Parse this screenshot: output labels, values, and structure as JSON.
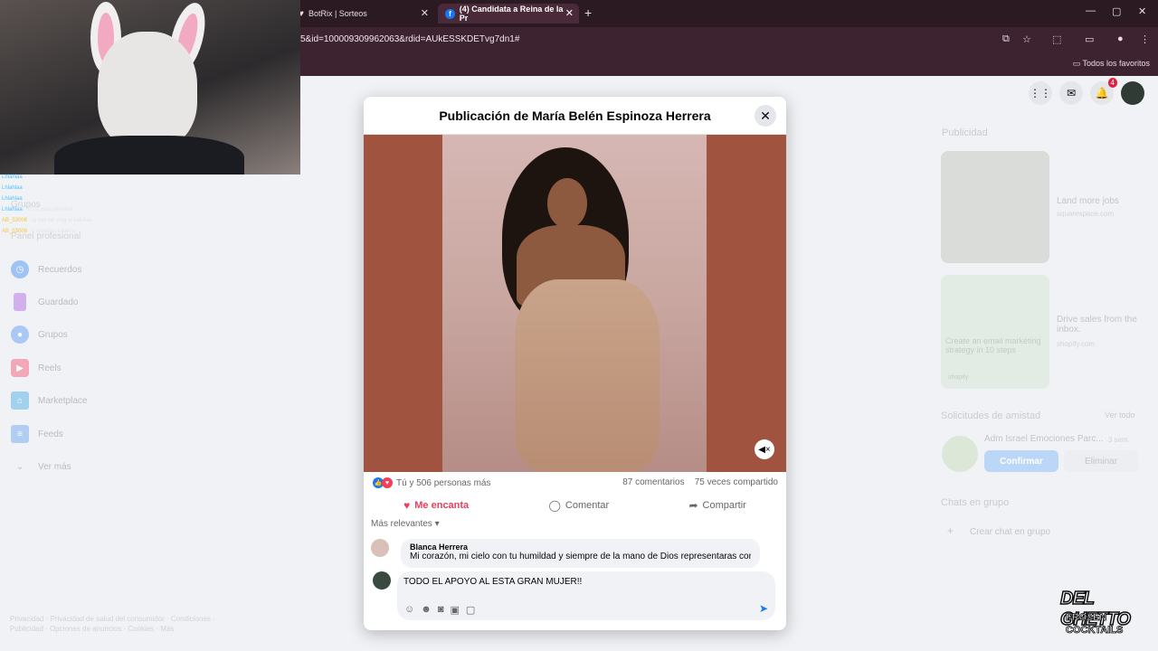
{
  "browser": {
    "tabs": [
      {
        "label": "BotRix | Sorteos"
      },
      {
        "label": "(4) Candidata a Reina de la Pr"
      }
    ],
    "url": "5&id=100009309962063&rdid=AUkESSKDETvg7dn1#",
    "bookmarks_label": "Todos los favoritos"
  },
  "chat_overlay": [
    {
      "name": "Lhlahlaa",
      "text": ":"
    },
    {
      "name": "Lhlahlaa",
      "text": ":"
    },
    {
      "name": "Lhlahlaa",
      "text": ":"
    },
    {
      "name": "Lhlahlaa",
      "text": ": Yo lo paso premios"
    },
    {
      "name": "AB_53006",
      "text": ": la sas vel v/ng al kalulala"
    },
    {
      "name": "AB_53006",
      "text": ": p grandes cabeza"
    }
  ],
  "leftnav": {
    "faded_top": [
      "Grupos",
      "Panel profesional"
    ],
    "items": [
      {
        "label": "Recuerdos",
        "color": "#1877f2"
      },
      {
        "label": "Guardado",
        "color": "#9c48d8"
      },
      {
        "label": "Grupos",
        "color": "#1877f2"
      },
      {
        "label": "Reels",
        "color": "#e4405f"
      },
      {
        "label": "Marketplace",
        "color": "#1b8fd1"
      },
      {
        "label": "Feeds",
        "color": "#1877f2"
      },
      {
        "label": "Ver más",
        "color": "#65676b"
      }
    ],
    "footer": "Privacidad · Privacidad de salud del consumidor · Condiciones · Publicidad · Opciones de anuncios · Cookies · Más"
  },
  "header": {
    "notifications_count": "4"
  },
  "rightcol": {
    "ads_title": "Publicidad",
    "ads": [
      {
        "title": "Land more jobs",
        "sub": "squarespace.com"
      },
      {
        "title": "Drive sales from the inbox.",
        "sub": "shopify.com",
        "card_text": "Create an email marketing strategy in 10 steps",
        "card_brand": "shopify"
      }
    ],
    "friend_requests_title": "Solicitudes de amistad",
    "see_all": "Ver todo",
    "friend_name": "Adm Israel Emociones Parc...",
    "friend_time": "3 sem",
    "confirm": "Confirmar",
    "delete": "Eliminar",
    "group_chats_title": "Chats en grupo",
    "create_group_chat": "Crear chat en grupo"
  },
  "modal": {
    "title": "Publicación de María Belén Espinoza Herrera",
    "reactions_text": "Tú y 506 personas más",
    "comments_count": "87 comentarios",
    "shares_count": "75 veces compartido",
    "actions": {
      "love": "Me encanta",
      "comment": "Comentar",
      "share": "Compartir"
    },
    "relevance": "Más relevantes",
    "comment": {
      "author": "Blanca Herrera",
      "text": "Mi corazón, mi cielo con tu humildad y siempre de la mano de Dios representaras con"
    },
    "composer_text": "TODO EL APOYO AL ESTA GRAN MUJER!!"
  },
  "logo": {
    "line1": "DEL GHETTO",
    "line2": "FROZEN",
    "line3": "COCKTAILS"
  },
  "colors": {
    "accent": "#1877f2",
    "love": "#e4405f",
    "media_bg": "#a0543f"
  }
}
